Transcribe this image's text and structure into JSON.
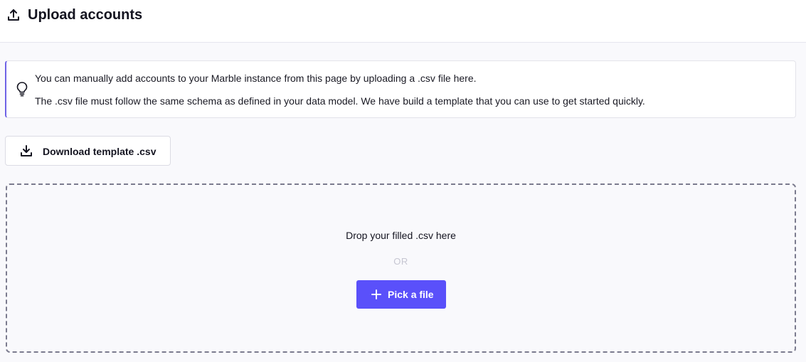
{
  "header": {
    "icon": "upload-icon",
    "title": "Upload accounts"
  },
  "callout": {
    "icon": "lightbulb-icon",
    "line1": "You can manually add accounts to your Marble instance from this page by uploading a .csv file here.",
    "line2": "The .csv file must follow the same schema as defined in your data model. We have build a template that you can use to get started quickly."
  },
  "download_button": {
    "icon": "download-icon",
    "label": "Download template .csv"
  },
  "dropzone": {
    "prompt": "Drop your filled .csv here",
    "separator": "OR",
    "pick_button": {
      "icon": "plus-icon",
      "label": "Pick a file"
    }
  },
  "colors": {
    "accent": "#5a50fa",
    "callout_border": "#6f63e6",
    "background": "#f9f9fc"
  }
}
